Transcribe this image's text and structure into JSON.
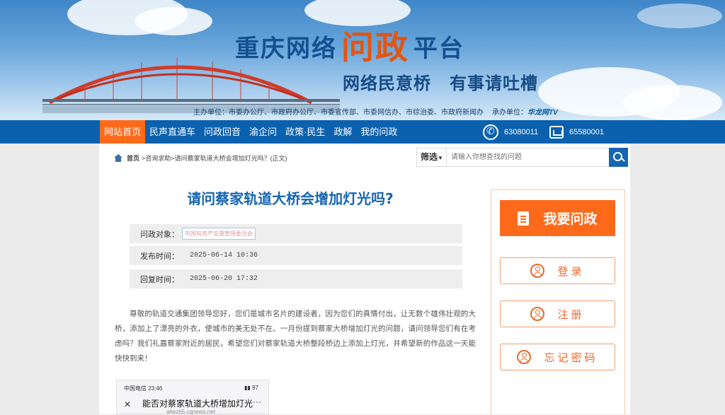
{
  "header": {
    "title_part1": "重庆网络",
    "title_highlight": "问政",
    "title_part2": "平台",
    "slogan_1": "网络民意桥",
    "slogan_2": "有事请吐槽",
    "sponsors_label": "主办单位：市委办公厅、市政府办公厅、市委宣传部、市委网信办、市综治委、市政府新闻办",
    "organizer_label": "承办单位：",
    "organizer_logo": "华龙网TV"
  },
  "nav": {
    "items": [
      "网站首页",
      "民声直通车",
      "问政回音",
      "渝企问",
      "政策·民生",
      "政解",
      "我的问政"
    ],
    "active_index": 0,
    "phone": "63080011",
    "fax": "65580001"
  },
  "breadcrumb": {
    "home": "首页",
    "sep1": " > ",
    "section": "咨询求助",
    "sep2": " > ",
    "current": "请问蔡家轨道大桥会增加灯光吗？(正文)"
  },
  "search": {
    "filter_label": "筛选",
    "placeholder": "请输入你想查找的问题"
  },
  "article": {
    "title": "请问蔡家轨道大桥会增加灯光吗?",
    "target_label": "问政对象：",
    "target_value": "市国有资产监督管理委员会",
    "published_label": "发布时间：",
    "published_value": "2025-06-14 10:36",
    "reply_label": "回复时间：",
    "reply_value": "2025-06-20 17:32",
    "body": "尊敬的轨道交通集团领导您好，您们是城市名片的建设者，因为您们的真情付出，让无数个雄伟壮观的大桥，添加上了漂亮的外衣，使城市的美无处不在。一月份提到蔡家大桥增加灯光的问题，请问领导您们有在考虑吗？我们礼嘉蔡家附近的居民，希望您们对蔡家轨道大桥整段桥边上添加上灯光，并希望新的作品这一天能快快到来！"
  },
  "phone_screenshot": {
    "status_left": "中国电信 23:46",
    "status_right": "▮▮ 97",
    "close": "✕",
    "title": "能否对蔡家轨道大桥增加灯光",
    "url": "wlwzh5.cqnews.net",
    "more": "···"
  },
  "sidebar": {
    "ask_label": "我要问政",
    "login_label": "登录",
    "register_label": "注册",
    "forgot_label": "忘记密码"
  },
  "colors": {
    "nav_bg": "#0b61ae",
    "accent": "#ff6a1a",
    "title_blue": "#1565b3"
  }
}
